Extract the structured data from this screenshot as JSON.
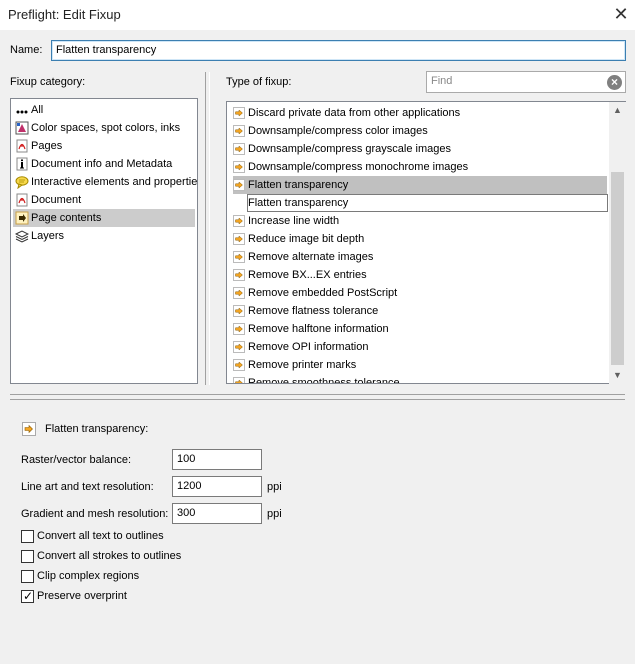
{
  "window": {
    "title": "Preflight: Edit Fixup",
    "close_glyph": "✕"
  },
  "name": {
    "label": "Name:",
    "value": "Flatten transparency"
  },
  "category": {
    "label": "Fixup category:",
    "items": [
      {
        "label": "All",
        "icon": "dots-icon"
      },
      {
        "label": "Color spaces, spot colors, inks",
        "icon": "color-icon"
      },
      {
        "label": "Pages",
        "icon": "pdf-icon"
      },
      {
        "label": "Document info and Metadata",
        "icon": "info-icon"
      },
      {
        "label": "Interactive elements and properties",
        "icon": "speech-icon"
      },
      {
        "label": "Document",
        "icon": "pdf-icon"
      },
      {
        "label": "Page contents",
        "icon": "arrow-icon"
      },
      {
        "label": "Layers",
        "icon": "layers-icon"
      }
    ],
    "selected": "Page contents"
  },
  "fixups": {
    "label": "Type of fixup:",
    "find_placeholder": "Find",
    "items": [
      "Discard private data from other applications",
      "Downsample/compress color images",
      "Downsample/compress grayscale images",
      "Downsample/compress monochrome images",
      "Flatten transparency",
      "Flatten transparency",
      "Increase line width",
      "Reduce image bit depth",
      "Remove alternate images",
      "Remove BX...EX entries",
      "Remove embedded PostScript",
      "Remove flatness tolerance",
      "Remove halftone information",
      "Remove OPI information",
      "Remove printer marks",
      "Remove smoothness tolerance"
    ],
    "selected": "Flatten transparency"
  },
  "details": {
    "heading": "Flatten transparency:",
    "raster_label": "Raster/vector balance:",
    "raster_value": "100",
    "lineart_label": "Line art and text resolution:",
    "lineart_value": "1200",
    "lineart_unit": "ppi",
    "gradient_label": "Gradient and mesh resolution:",
    "gradient_value": "300",
    "gradient_unit": "ppi",
    "checkboxes": [
      {
        "label": "Convert all text to outlines",
        "checked": false
      },
      {
        "label": "Convert all strokes to outlines",
        "checked": false
      },
      {
        "label": "Clip complex regions",
        "checked": false
      },
      {
        "label": "Preserve overprint",
        "checked": true
      }
    ]
  },
  "colors": {
    "accent": "#3c7fb1",
    "selection": "#cccccc",
    "icon_orange": "#f5a623"
  }
}
